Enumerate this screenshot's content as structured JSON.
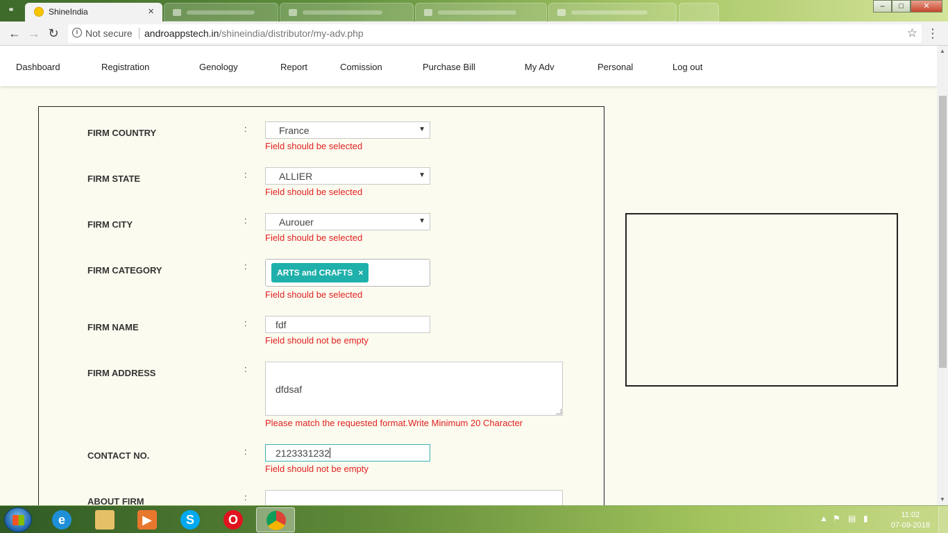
{
  "browser": {
    "active_tab": {
      "title": "ShineIndia",
      "close": "×"
    },
    "url": {
      "security": "Not secure",
      "host": "androappstech.in",
      "path": "/shineindia/distributor/my-adv.php"
    },
    "window_buttons": {
      "minimize": "–",
      "maximize": "□",
      "close": "✕"
    }
  },
  "nav": {
    "items": [
      {
        "label": "Dashboard"
      },
      {
        "label": "Registration"
      },
      {
        "label": "Genology"
      },
      {
        "label": "Report"
      },
      {
        "label": "Comission"
      },
      {
        "label": "Purchase Bill"
      },
      {
        "label": "My Adv"
      },
      {
        "label": "Personal"
      },
      {
        "label": "Log out"
      }
    ]
  },
  "form": {
    "colon": ":",
    "country": {
      "label": "FIRM COUNTRY",
      "value": "France",
      "error": "Field should be selected"
    },
    "state": {
      "label": "FIRM STATE",
      "value": "ALLIER",
      "error": "Field should be selected"
    },
    "city": {
      "label": "FIRM CITY",
      "value": "Aurouer",
      "error": "Field should be selected"
    },
    "category": {
      "label": "FIRM CATEGORY",
      "tag": "ARTS and CRAFTS",
      "tag_remove": "×",
      "error": "Field should be selected"
    },
    "name": {
      "label": "FIRM NAME",
      "value": "fdf",
      "error": "Field should not be empty"
    },
    "address": {
      "label": "FIRM ADDRESS",
      "value": "dfdsaf",
      "error": "Please match the requested format.Write Minimum 20 Character"
    },
    "contact": {
      "label": "CONTACT NO.",
      "value": "2123331232",
      "error": "Field should not be empty"
    },
    "about": {
      "label": "ABOUT FIRM",
      "value": ""
    }
  },
  "taskbar": {
    "time": "11:02",
    "date": "07-09-2018"
  },
  "icons": {
    "back": "back-arrow-icon",
    "forward": "forward-arrow-icon",
    "reload": "reload-icon",
    "star": "bookmark-star-icon",
    "menu": "chrome-menu-icon"
  }
}
